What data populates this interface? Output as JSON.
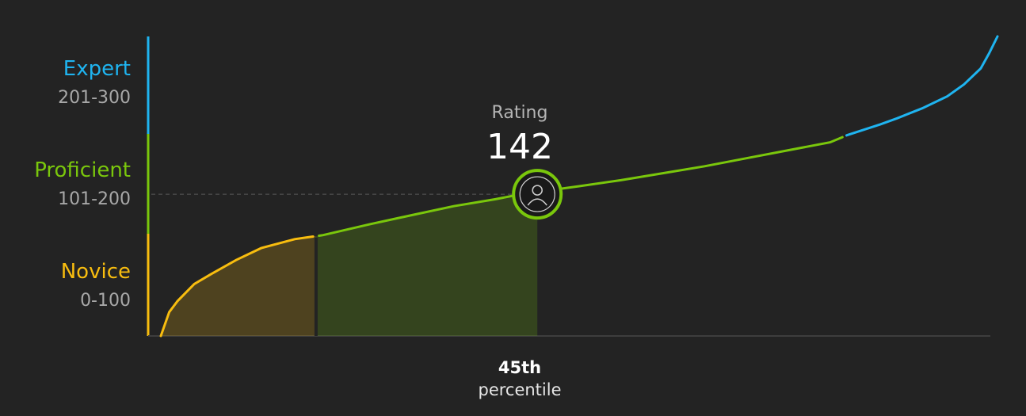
{
  "chart_data": {
    "type": "area",
    "xlabel": "",
    "ylabel": "",
    "xlim": [
      0,
      100
    ],
    "ylim": [
      0,
      300
    ],
    "bands": [
      {
        "name": "Expert",
        "range": "201-300",
        "min": 201,
        "max": 300,
        "color": "#1fb4f0"
      },
      {
        "name": "Proficient",
        "range": "101-200",
        "min": 101,
        "max": 200,
        "color": "#7ac70c"
      },
      {
        "name": "Novice",
        "range": "0-100",
        "min": 0,
        "max": 100,
        "color": "#f8bd0f"
      }
    ],
    "curve": {
      "x": [
        0,
        1,
        2,
        4,
        6,
        9,
        12,
        16,
        19.4,
        25,
        30,
        35,
        40,
        43,
        50,
        55,
        60,
        65,
        70,
        75,
        80,
        82,
        86,
        88,
        91,
        94,
        96,
        98,
        99,
        100
      ],
      "y": [
        0,
        24,
        35,
        52,
        62,
        76,
        88,
        97,
        101,
        112,
        121,
        130,
        137,
        142,
        150,
        156,
        163,
        170,
        178,
        186,
        194,
        201,
        212,
        218,
        228,
        240,
        252,
        268,
        283,
        300
      ]
    },
    "marker": {
      "rating_label": "Rating",
      "rating": 142,
      "percentile_label": "percentile",
      "percentile_text": "45th",
      "percentile": 45
    }
  }
}
